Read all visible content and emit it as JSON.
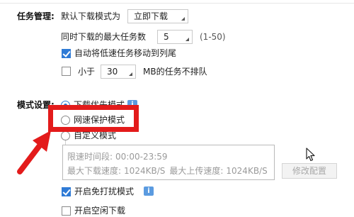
{
  "task_management": {
    "section_label": "任务管理:",
    "default_mode_label": "默认下载模式为",
    "default_mode_value": "立即下载",
    "max_tasks_label": "同时下载的最大任务数",
    "max_tasks_value": "5",
    "max_tasks_range": "(1-50)",
    "move_slow_label": "自动将低速任务移动到列尾",
    "move_slow_checked": true,
    "less_than_label": "小于",
    "less_than_value": "30",
    "less_than_suffix": "MB的任务不排队",
    "less_than_checked": false
  },
  "mode_settings": {
    "section_label": "模式设置:",
    "options": [
      {
        "label": "下载优先模式",
        "selected": true
      },
      {
        "label": "网速保护模式",
        "selected": false
      },
      {
        "label": "自定义模式",
        "selected": false
      }
    ],
    "info_icon_glyph": "i",
    "custom_box": {
      "time_label": "限速时间段:",
      "time_value": "00:00-23:59",
      "max_download_label": "最大下载速度:",
      "max_download_value": "1024KB/S",
      "max_upload_label": "最大上传速度:",
      "max_upload_value": "1024KB/S",
      "edit_button_label": "修改配置"
    },
    "no_disturb_label": "开启免打扰模式",
    "no_disturb_checked": true,
    "idle_download_label": "开启空闲下载",
    "idle_download_checked": false
  },
  "annotation": {
    "color": "#e31b1b"
  }
}
